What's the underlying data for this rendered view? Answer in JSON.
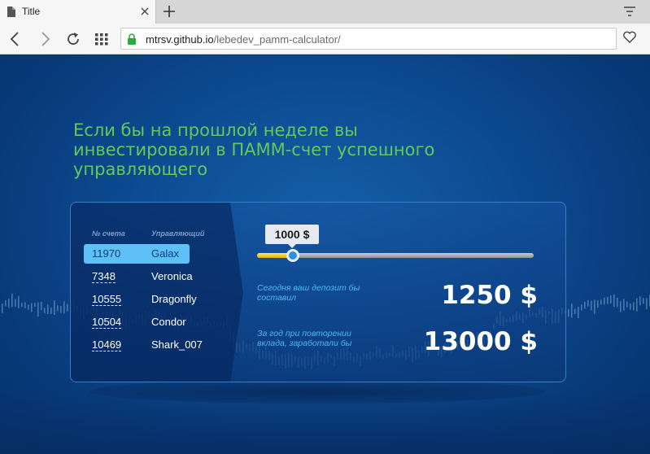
{
  "browser": {
    "tab_title": "Title",
    "url_host": "mtrsv.github.io",
    "url_path": "/lebedev_pamm-calculator/"
  },
  "page": {
    "headline": "Если бы на прошлой неделе вы инвестировали в ПАММ-счет успешного управляющего"
  },
  "calculator": {
    "col_account": "№ счета",
    "col_manager": "Управляющий",
    "rows": [
      {
        "account": "11970",
        "manager": "Galax",
        "selected": true
      },
      {
        "account": "7348",
        "manager": "Veronica",
        "selected": false
      },
      {
        "account": "10555",
        "manager": "Dragonfly",
        "selected": false
      },
      {
        "account": "10504",
        "manager": "Condor",
        "selected": false
      },
      {
        "account": "10469",
        "manager": "Shark_007",
        "selected": false
      }
    ],
    "amount_label": "1000 $",
    "slider_fraction": 0.13,
    "deposit_caption": "Сегодня ваш депозит бы составил",
    "deposit_value": "1250 $",
    "year_caption": "За год при повторении вклада, заработали бы",
    "year_value": "13000 $"
  },
  "colors": {
    "headline": "#62c95a",
    "selected_row": "#5ec0f6",
    "caption": "#4fb8ee",
    "slider_fill": "#f2c400"
  }
}
